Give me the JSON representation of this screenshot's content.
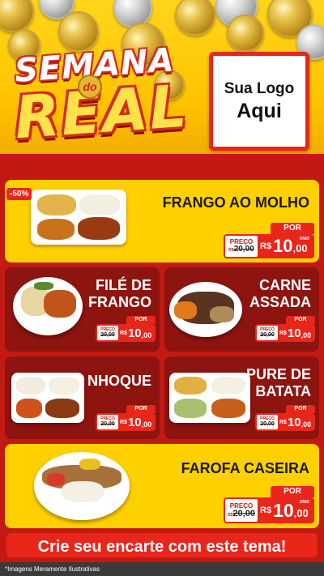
{
  "header": {
    "title_line1": "SEMANA",
    "title_de": "do",
    "title_line2": "REAL",
    "logo_line1": "Sua Logo",
    "logo_line2": "Aqui"
  },
  "labels": {
    "por": "POR",
    "preco": "PREÇO",
    "rs": "R$",
    "unid": "UNID",
    "currency_small": "R$"
  },
  "products": [
    {
      "name": "FRANGO AO MOLHO",
      "old_price": "20,00",
      "price_int": "10",
      "price_dec": ",00",
      "discount": "-50%"
    },
    {
      "name_line1": "FILÉ DE",
      "name_line2": "FRANGO",
      "old_price": "20,00",
      "price_int": "10",
      "price_dec": ",00"
    },
    {
      "name_line1": "CARNE",
      "name_line2": "ASSADA",
      "old_price": "20,00",
      "price_int": "10",
      "price_dec": ",00"
    },
    {
      "name": "NHOQUE",
      "old_price": "20,00",
      "price_int": "10",
      "price_dec": ",00"
    },
    {
      "name_line1": "PURE DE",
      "name_line2": "BATATA",
      "old_price": "20,00",
      "price_int": "10",
      "price_dec": ",00"
    },
    {
      "name": "FAROFA CASEIRA",
      "old_price": "20,00",
      "price_int": "10",
      "price_dec": ",00"
    }
  ],
  "cta": "Crie seu encarte com este tema!",
  "footer": "*Imagens Meramente Ilustrativas",
  "colors": {
    "red": "#e8261a",
    "dark_red": "#8e1410",
    "yellow": "#ffd000"
  }
}
